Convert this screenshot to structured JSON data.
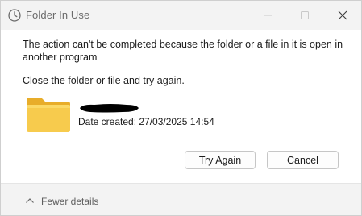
{
  "window": {
    "title": "Folder In Use",
    "title_icon": "clock-icon",
    "controls": [
      "minimize-icon",
      "maximize-icon",
      "close-icon"
    ]
  },
  "message": {
    "text": "The action can't be completed because the folder or a file in it is open in another program",
    "instruction": "Close the folder or file and try again."
  },
  "item": {
    "icon": "folder-icon",
    "name_redacted": true,
    "date_created": "Date created: 27/03/2025 14:54"
  },
  "buttons": {
    "try_again": "Try Again",
    "cancel": "Cancel"
  },
  "footer": {
    "toggle_label": "Fewer details",
    "toggle_icon": "chevron-up-icon"
  },
  "colors": {
    "titlebar_bg": "#f3f3f3",
    "folder_yellow": "#f5c544",
    "folder_tab": "#e8ad2a",
    "redaction": "#000000"
  }
}
